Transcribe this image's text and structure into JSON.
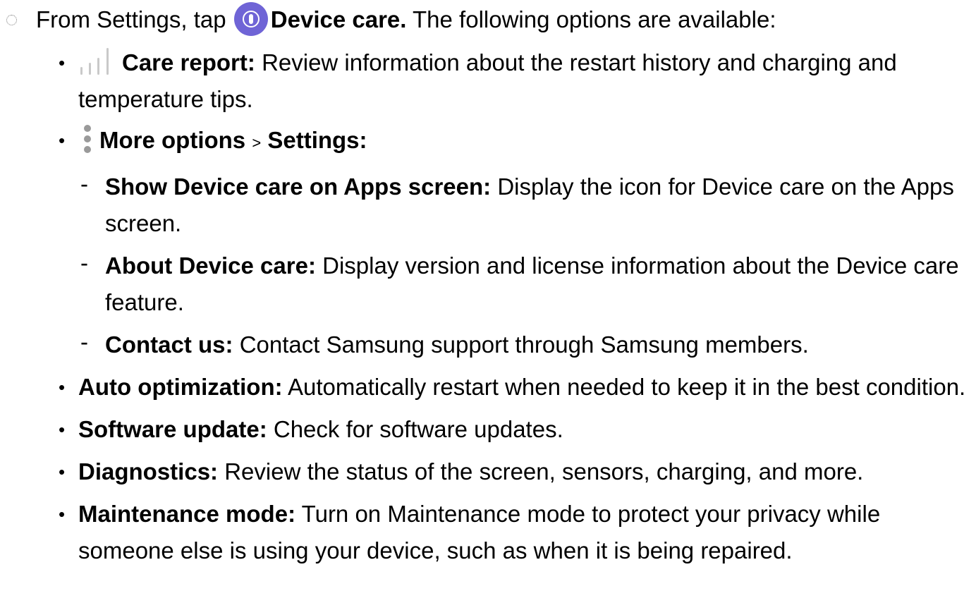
{
  "step": {
    "prefix": "From Settings, tap",
    "app_name": "Device care.",
    "suffix": "The following options are available:",
    "app_icon": "device-care-icon"
  },
  "options": [
    {
      "icon": "bar-chart-icon",
      "title": "Care report",
      "colon": ":",
      "text": "Review information about the restart history and charging and temperature tips."
    },
    {
      "icon": "more-options-icon",
      "title": "More options",
      "separator": ">",
      "title2": "Settings",
      "colon": ":",
      "sub": [
        {
          "title": "Show Device care on Apps screen",
          "colon": ":",
          "text": "Display the icon for Device care on the Apps screen."
        },
        {
          "title": "About Device care",
          "colon": ":",
          "text": "Display version and license information about the Device care feature."
        },
        {
          "title": "Contact us",
          "colon": ":",
          "text": "Contact Samsung support through Samsung members."
        }
      ]
    },
    {
      "title": "Auto optimization",
      "colon": ":",
      "text": "Automatically restart when needed to keep it in the best condition."
    },
    {
      "title": "Software update",
      "colon": ":",
      "text": "Check for software updates."
    },
    {
      "title": "Diagnostics",
      "colon": ":",
      "text": "Review the status of the screen, sensors, charging, and more."
    },
    {
      "title": "Maintenance mode",
      "colon": ":",
      "text": "Turn on Maintenance mode to protect your privacy while someone else is using your device, such as when it is being repaired."
    }
  ],
  "colors": {
    "icon_accent": "#6f64d6",
    "icon_gray": "#9a9a9a",
    "icon_light": "#c9c9c9"
  }
}
